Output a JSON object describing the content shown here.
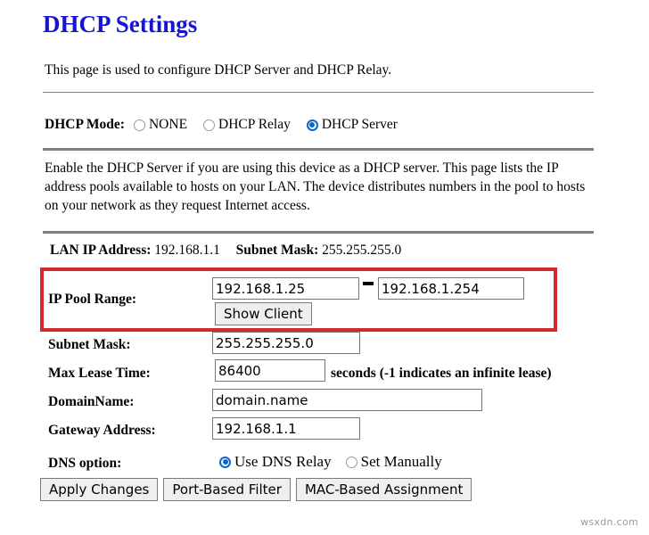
{
  "page": {
    "title": "DHCP Settings",
    "intro": "This page is used to configure DHCP Server and DHCP Relay.",
    "description": "Enable the DHCP Server if you are using this device as a DHCP server. This page lists the IP address pools available to hosts on your LAN. The device distributes numbers in the pool to hosts on your network as they request Internet access.",
    "title_color": "#1414d2",
    "highlight_color": "#d32b2b",
    "accent_color": "#0a64d2"
  },
  "mode": {
    "label": "DHCP Mode:",
    "options": [
      {
        "label": "NONE",
        "selected": false
      },
      {
        "label": "DHCP Relay",
        "selected": false
      },
      {
        "label": "DHCP Server",
        "selected": true
      }
    ]
  },
  "lan_info": {
    "ip_label": "LAN IP Address:",
    "ip_value": "192.168.1.1",
    "mask_label": "Subnet Mask:",
    "mask_value": "255.255.255.0"
  },
  "form": {
    "ip_pool": {
      "label": "IP Pool Range:",
      "start_value": "192.168.1.25",
      "end_value": "192.168.1.254",
      "separator": "-",
      "show_client_label": "Show Client"
    },
    "subnet_mask": {
      "label": "Subnet Mask:",
      "value": "255.255.255.0"
    },
    "max_lease_time": {
      "label": "Max Lease Time:",
      "value": "86400",
      "hint": "seconds (-1 indicates an infinite lease)"
    },
    "domain_name": {
      "label": "DomainName:",
      "value": "domain.name"
    },
    "gateway_address": {
      "label": "Gateway Address:",
      "value": "192.168.1.1"
    },
    "dns_option": {
      "label": "DNS option:",
      "options": [
        {
          "label": "Use DNS Relay",
          "selected": true
        },
        {
          "label": "Set Manually",
          "selected": false
        }
      ]
    }
  },
  "buttons": {
    "apply": "Apply Changes",
    "port_filter": "Port-Based Filter",
    "mac_assignment": "MAC-Based Assignment"
  },
  "watermark": "wsxdn.com"
}
